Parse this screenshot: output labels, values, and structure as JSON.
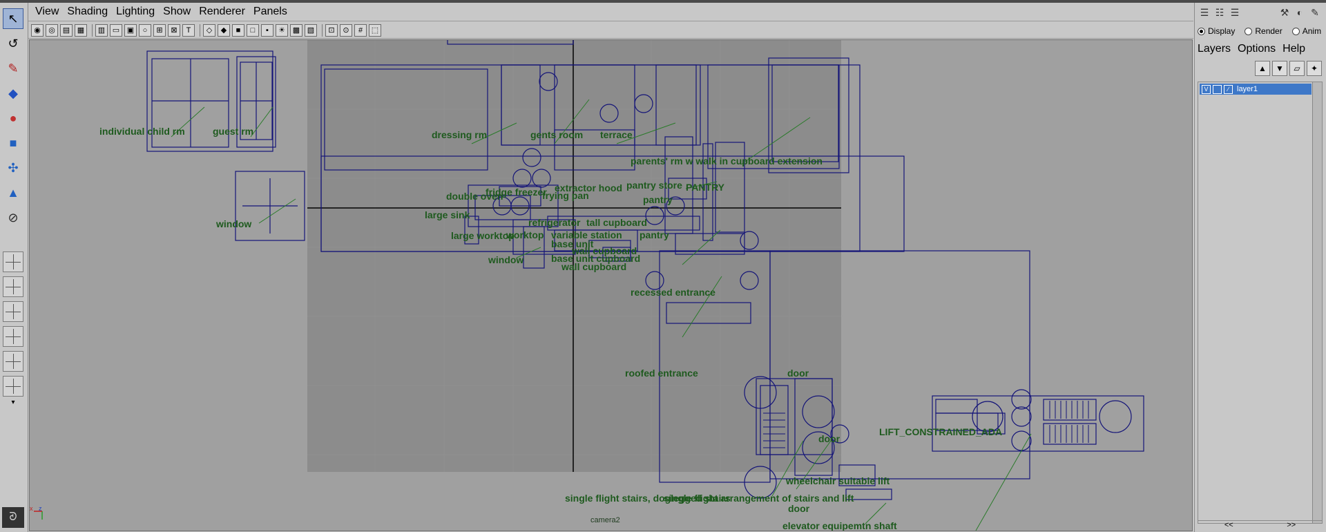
{
  "panel_menu": [
    "View",
    "Shading",
    "Lighting",
    "Show",
    "Renderer",
    "Panels"
  ],
  "camera_label": "camera2",
  "axis_labels": {
    "x": "x",
    "z": "z"
  },
  "labels": [
    "individual child rm",
    "guest rm",
    "window",
    "dressing rm",
    "gents  room",
    "terrace",
    "parents' rm w walk in cupboard extension",
    "pantry store",
    "PANTRY",
    "pantry",
    "double oven",
    "fridge freezer",
    "extractor hood",
    "frying pan",
    "large sink",
    "large worktop",
    "refrigerator",
    "tall cupboard",
    "worktop",
    "variable station",
    "pantry",
    "base unit",
    "wall cupboard",
    "window",
    "base unit cupboard",
    "wall cupboard",
    "recessed entrance",
    "roofed entrance",
    "door",
    "door",
    "LIFT_CONSTRAINED_ADA",
    "wheelchair suitable lift",
    "single flight stairs, doglegged stairs",
    "single flight arrangement of stairs and lift",
    "door",
    "elevator equipemtn shaft"
  ],
  "layer_editor": {
    "modes": [
      "Display",
      "Render",
      "Anim"
    ],
    "active_mode": "Display",
    "menu": [
      "Layers",
      "Options",
      "Help"
    ],
    "layers": [
      {
        "visible": "V",
        "name": "layer1"
      }
    ],
    "scroll": [
      "<<",
      ">>"
    ]
  },
  "colors": {
    "wireframe": "#141478",
    "label": "#1e5a1e",
    "grid_bg": "#8c8c8c",
    "viewport_bg": "#a0a0a0",
    "selected_layer": "#3e78c8"
  },
  "icons": [
    "select-tool-icon",
    "lasso-tool-icon",
    "paint-tool-icon",
    "move-tool-icon",
    "rotate-tool-icon",
    "scale-tool-icon",
    "universal-manipulator-icon",
    "soft-mod-icon",
    "show-manipulator-icon",
    "last-tool-icon"
  ]
}
